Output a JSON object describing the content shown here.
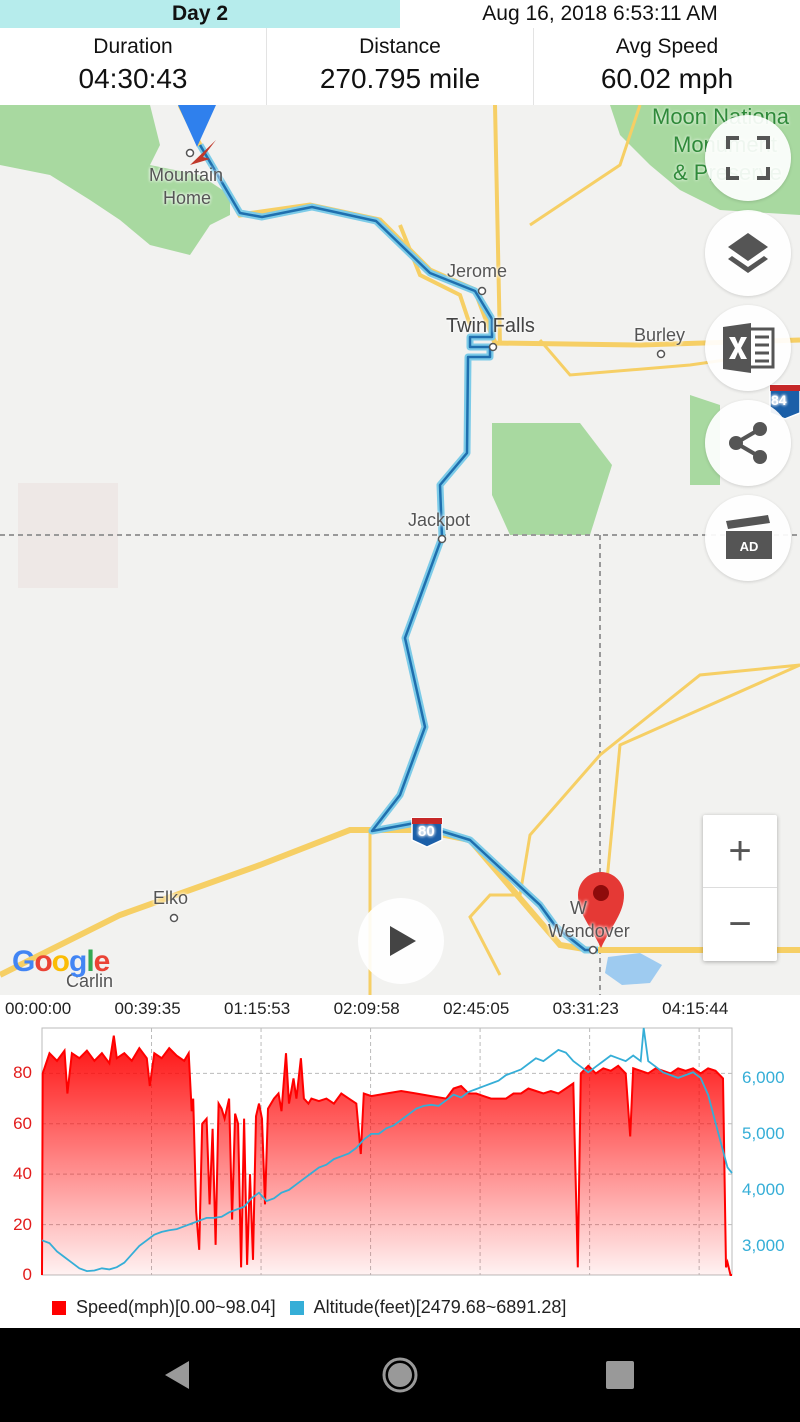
{
  "header": {
    "day_tab": "Day 2",
    "datetime": "Aug 16, 2018 6:53:11 AM"
  },
  "stats": [
    {
      "label": "Duration",
      "value": "04:30:43"
    },
    {
      "label": "Distance",
      "value": "270.795 mile"
    },
    {
      "label": "Avg Speed",
      "value": "60.02 mph"
    }
  ],
  "map": {
    "places": {
      "mountain_home_1": "Mountain",
      "mountain_home_2": "Home",
      "jerome": "Jerome",
      "twin_falls": "Twin Falls",
      "burley": "Burley",
      "jackpot": "Jackpot",
      "elko": "Elko",
      "carlin": "Carlin",
      "west_wendover_1": "W",
      "west_wendover_2": "Wendover",
      "park_1": "Moon Nationa",
      "park_2": "Monument",
      "park_3": "& Preserve"
    },
    "shields": {
      "i84": "84",
      "i80": "80"
    },
    "google_logo": "Google",
    "controls": [
      "fullscreen-icon",
      "layers-icon",
      "excel-icon",
      "share-icon",
      "ad-icon"
    ],
    "zoom_in": "+",
    "zoom_out": "−",
    "colors": {
      "route": "#1f6fae",
      "route_glow": "#7ccbe8",
      "highway": "#f6cf65",
      "park": "#a8d9a0",
      "end_pin": "#e53935",
      "start_pin": "#2f80ed"
    }
  },
  "chart_data": {
    "type": "area",
    "title": "",
    "x_ticks": [
      "00:00:00",
      "00:39:35",
      "01:15:53",
      "02:09:58",
      "02:45:05",
      "03:31:23",
      "04:15:44"
    ],
    "y_left_ticks": [
      "0",
      "20",
      "40",
      "60",
      "80"
    ],
    "y_right_ticks": [
      "3,000",
      "4,000",
      "5,000",
      "6,000"
    ],
    "ylim_left": [
      0,
      98
    ],
    "ylim_right": [
      2480,
      6891
    ],
    "series": [
      {
        "name": "Speed(mph)[0.00~98.04]",
        "color": "#ff0000",
        "points": [
          [
            0,
            0
          ],
          [
            0.5,
            80
          ],
          [
            5,
            88
          ],
          [
            10,
            85
          ],
          [
            15,
            89
          ],
          [
            17,
            72
          ],
          [
            20,
            88
          ],
          [
            25,
            86
          ],
          [
            30,
            89
          ],
          [
            35,
            85
          ],
          [
            40,
            88
          ],
          [
            45,
            84
          ],
          [
            48,
            95
          ],
          [
            50,
            86
          ],
          [
            55,
            88
          ],
          [
            60,
            85
          ],
          [
            65,
            90
          ],
          [
            70,
            86
          ],
          [
            72,
            75
          ],
          [
            75,
            88
          ],
          [
            80,
            86
          ],
          [
            85,
            90
          ],
          [
            90,
            87
          ],
          [
            95,
            85
          ],
          [
            98,
            88
          ],
          [
            100,
            65
          ],
          [
            101,
            70
          ],
          [
            103,
            25
          ],
          [
            105,
            10
          ],
          [
            107,
            60
          ],
          [
            110,
            62
          ],
          [
            112,
            28
          ],
          [
            114,
            58
          ],
          [
            116,
            12
          ],
          [
            118,
            68
          ],
          [
            120,
            66
          ],
          [
            122,
            62
          ],
          [
            125,
            70
          ],
          [
            127,
            22
          ],
          [
            129,
            64
          ],
          [
            131,
            60
          ],
          [
            133,
            3
          ],
          [
            135,
            62
          ],
          [
            137,
            4
          ],
          [
            139,
            40
          ],
          [
            141,
            6
          ],
          [
            143,
            63
          ],
          [
            145,
            68
          ],
          [
            147,
            62
          ],
          [
            149,
            28
          ],
          [
            151,
            66
          ],
          [
            155,
            70
          ],
          [
            158,
            72
          ],
          [
            160,
            65
          ],
          [
            163,
            88
          ],
          [
            165,
            68
          ],
          [
            168,
            78
          ],
          [
            170,
            70
          ],
          [
            173,
            86
          ],
          [
            175,
            70
          ],
          [
            178,
            68
          ],
          [
            180,
            70
          ],
          [
            185,
            69
          ],
          [
            190,
            70
          ],
          [
            195,
            68
          ],
          [
            200,
            72
          ],
          [
            205,
            70
          ],
          [
            210,
            68
          ],
          [
            213,
            48
          ],
          [
            215,
            72
          ],
          [
            220,
            71
          ],
          [
            230,
            72
          ],
          [
            240,
            73
          ],
          [
            250,
            72
          ],
          [
            260,
            71
          ],
          [
            270,
            70
          ],
          [
            275,
            74
          ],
          [
            280,
            75
          ],
          [
            285,
            72
          ],
          [
            290,
            72
          ],
          [
            295,
            71
          ],
          [
            300,
            70
          ],
          [
            305,
            70
          ],
          [
            310,
            70
          ],
          [
            315,
            72
          ],
          [
            320,
            72
          ],
          [
            325,
            74
          ],
          [
            330,
            73
          ],
          [
            335,
            72
          ],
          [
            340,
            73
          ],
          [
            345,
            72
          ],
          [
            350,
            74
          ],
          [
            355,
            76
          ],
          [
            358,
            3
          ],
          [
            360,
            80
          ],
          [
            365,
            83
          ],
          [
            370,
            80
          ],
          [
            375,
            82
          ],
          [
            380,
            81
          ],
          [
            385,
            83
          ],
          [
            390,
            80
          ],
          [
            393,
            55
          ],
          [
            395,
            82
          ],
          [
            400,
            81
          ],
          [
            405,
            80
          ],
          [
            410,
            82
          ],
          [
            415,
            81
          ],
          [
            420,
            80
          ],
          [
            425,
            82
          ],
          [
            430,
            81
          ],
          [
            435,
            82
          ],
          [
            440,
            80
          ],
          [
            445,
            82
          ],
          [
            450,
            81
          ],
          [
            455,
            78
          ],
          [
            457,
            3
          ],
          [
            458,
            5
          ],
          [
            460,
            0
          ],
          [
            461,
            0
          ]
        ]
      },
      {
        "name": "Altitude(feet)[2479.68~6891.28]",
        "color": "#35aed7",
        "points": [
          [
            0,
            3100
          ],
          [
            5,
            3050
          ],
          [
            10,
            2900
          ],
          [
            15,
            2800
          ],
          [
            20,
            2700
          ],
          [
            25,
            2600
          ],
          [
            30,
            2550
          ],
          [
            35,
            2560
          ],
          [
            40,
            2600
          ],
          [
            45,
            2580
          ],
          [
            50,
            2620
          ],
          [
            55,
            2700
          ],
          [
            60,
            2850
          ],
          [
            65,
            3000
          ],
          [
            70,
            3100
          ],
          [
            75,
            3200
          ],
          [
            80,
            3250
          ],
          [
            85,
            3280
          ],
          [
            90,
            3300
          ],
          [
            95,
            3350
          ],
          [
            100,
            3400
          ],
          [
            105,
            3450
          ],
          [
            110,
            3500
          ],
          [
            115,
            3500
          ],
          [
            120,
            3520
          ],
          [
            125,
            3600
          ],
          [
            130,
            3650
          ],
          [
            135,
            3700
          ],
          [
            140,
            3850
          ],
          [
            145,
            3950
          ],
          [
            150,
            3800
          ],
          [
            155,
            3850
          ],
          [
            160,
            3950
          ],
          [
            165,
            4000
          ],
          [
            170,
            4100
          ],
          [
            175,
            4200
          ],
          [
            180,
            4300
          ],
          [
            185,
            4400
          ],
          [
            190,
            4450
          ],
          [
            195,
            4550
          ],
          [
            200,
            4600
          ],
          [
            205,
            4650
          ],
          [
            210,
            4750
          ],
          [
            215,
            4900
          ],
          [
            220,
            5000
          ],
          [
            225,
            5000
          ],
          [
            230,
            5100
          ],
          [
            235,
            5150
          ],
          [
            240,
            5250
          ],
          [
            245,
            5350
          ],
          [
            250,
            5450
          ],
          [
            255,
            5500
          ],
          [
            260,
            5520
          ],
          [
            265,
            5500
          ],
          [
            270,
            5600
          ],
          [
            275,
            5700
          ],
          [
            280,
            5650
          ],
          [
            285,
            5750
          ],
          [
            290,
            5800
          ],
          [
            295,
            5850
          ],
          [
            300,
            5900
          ],
          [
            305,
            5950
          ],
          [
            310,
            6050
          ],
          [
            315,
            6100
          ],
          [
            320,
            6150
          ],
          [
            325,
            6250
          ],
          [
            330,
            6350
          ],
          [
            335,
            6300
          ],
          [
            340,
            6400
          ],
          [
            345,
            6500
          ],
          [
            350,
            6450
          ],
          [
            355,
            6300
          ],
          [
            360,
            6200
          ],
          [
            365,
            6100
          ],
          [
            370,
            6200
          ],
          [
            375,
            6300
          ],
          [
            380,
            6400
          ],
          [
            385,
            6350
          ],
          [
            390,
            6300
          ],
          [
            395,
            6400
          ],
          [
            400,
            6300
          ],
          [
            402,
            6891
          ],
          [
            405,
            6300
          ],
          [
            410,
            6200
          ],
          [
            415,
            6100
          ],
          [
            420,
            6050
          ],
          [
            425,
            6000
          ],
          [
            430,
            6050
          ],
          [
            435,
            6100
          ],
          [
            440,
            6000
          ],
          [
            445,
            5700
          ],
          [
            450,
            5200
          ],
          [
            455,
            4700
          ],
          [
            458,
            4400
          ],
          [
            461,
            4300
          ]
        ]
      }
    ],
    "x_range_minutes": [
      0,
      461
    ],
    "grid": true
  },
  "nav": [
    "back-icon",
    "home-icon",
    "recents-icon"
  ]
}
